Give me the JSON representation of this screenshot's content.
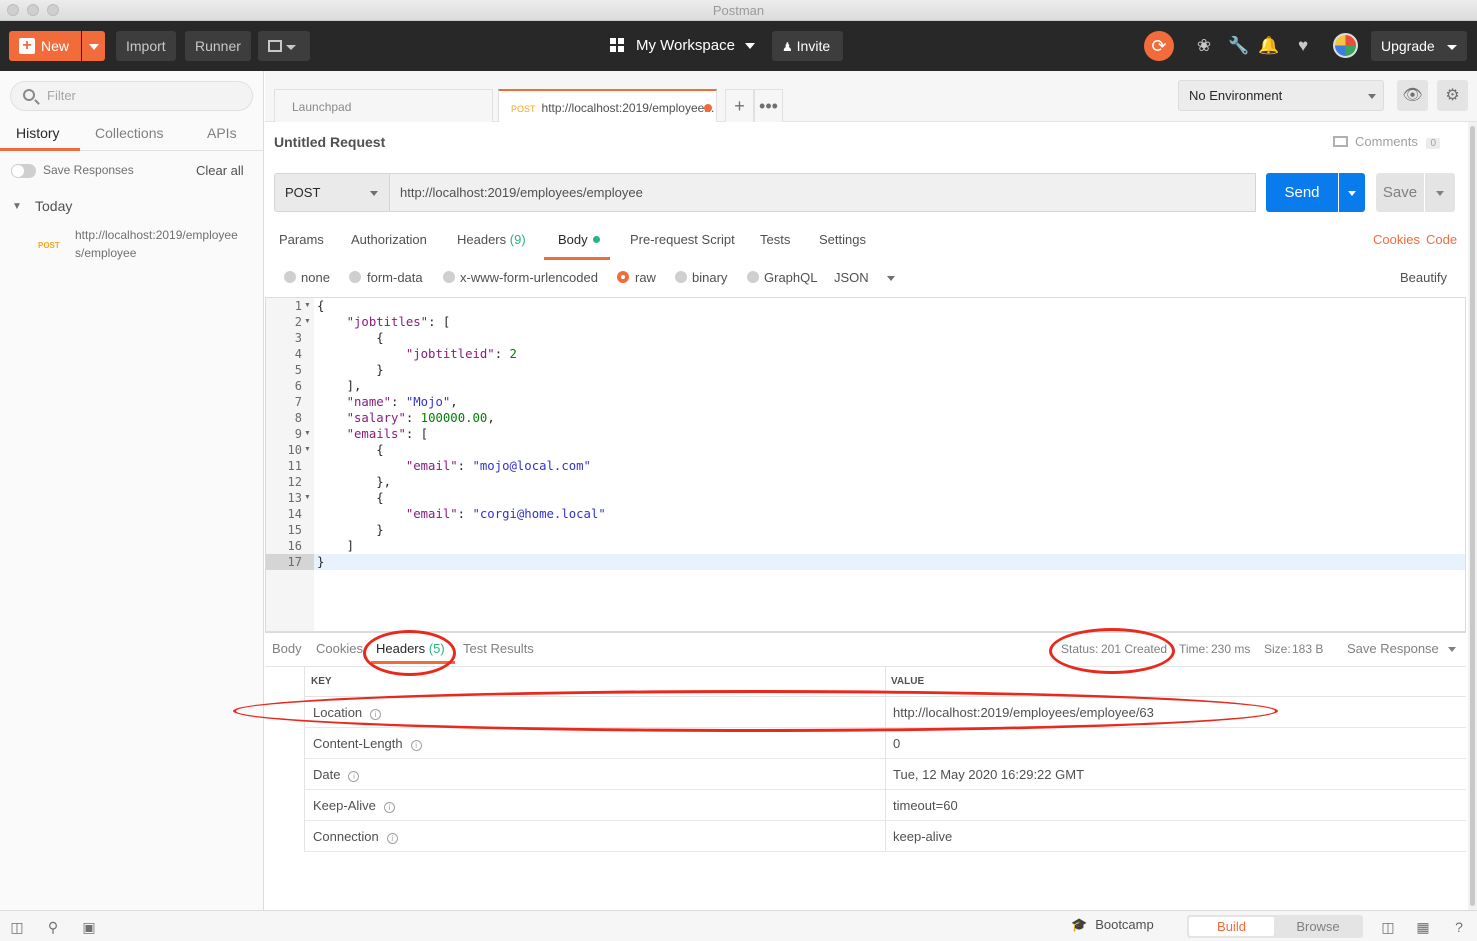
{
  "window": {
    "title": "Postman"
  },
  "header": {
    "new_label": "New",
    "import_label": "Import",
    "runner_label": "Runner",
    "workspace_label": "My Workspace",
    "invite_label": "Invite",
    "upgrade_label": "Upgrade"
  },
  "sidebar": {
    "filter_placeholder": "Filter",
    "tabs": [
      "History",
      "Collections",
      "APIs"
    ],
    "save_responses_label": "Save Responses",
    "clear_all_label": "Clear all",
    "group_label": "Today",
    "history_items": [
      {
        "method": "POST",
        "url_line1": "http://localhost:2019/employee",
        "url_line2": "s/employee"
      }
    ]
  },
  "tabs": {
    "launchpad_label": "Launchpad",
    "active_method": "POST",
    "active_label": "http://localhost:2019/employee..."
  },
  "environment": {
    "selected": "No Environment"
  },
  "request": {
    "title": "Untitled Request",
    "comments_label": "Comments",
    "comments_count": "0",
    "method": "POST",
    "url": "http://localhost:2019/employees/employee",
    "send_label": "Send",
    "save_label": "Save",
    "tabs": {
      "params": "Params",
      "authorization": "Authorization",
      "headers": "Headers",
      "headers_count": "(9)",
      "body": "Body",
      "prerequest": "Pre-request Script",
      "tests": "Tests",
      "settings": "Settings"
    },
    "cookies_label": "Cookies",
    "code_label": "Code",
    "body_types": [
      "none",
      "form-data",
      "x-www-form-urlencoded",
      "raw",
      "binary",
      "GraphQL"
    ],
    "body_format": "JSON",
    "beautify_label": "Beautify"
  },
  "editor": {
    "lines": [
      "{",
      "    \"jobtitles\": [",
      "        {",
      "            \"jobtitleid\": 2",
      "        }",
      "    ],",
      "    \"name\": \"Mojo\",",
      "    \"salary\": 100000.00,",
      "    \"emails\": [",
      "        {",
      "            \"email\": \"mojo@local.com\"",
      "        },",
      "        {",
      "            \"email\": \"corgi@home.local\"",
      "        }",
      "    ]",
      "}"
    ]
  },
  "response": {
    "tabs": {
      "body": "Body",
      "cookies": "Cookies",
      "headers": "Headers",
      "headers_count": "(5)",
      "test_results": "Test Results"
    },
    "status_label": "Status:",
    "status_value": "201 Created",
    "time_label": "Time:",
    "time_value": "230 ms",
    "size_label": "Size:",
    "size_value": "183 B",
    "save_response_label": "Save Response",
    "table": {
      "key_header": "KEY",
      "value_header": "VALUE",
      "rows": [
        {
          "key": "Location",
          "value": "http://localhost:2019/employees/employee/63"
        },
        {
          "key": "Content-Length",
          "value": "0"
        },
        {
          "key": "Date",
          "value": "Tue, 12 May 2020 16:29:22 GMT"
        },
        {
          "key": "Keep-Alive",
          "value": "timeout=60"
        },
        {
          "key": "Connection",
          "value": "keep-alive"
        }
      ]
    }
  },
  "statusbar": {
    "bootcamp_label": "Bootcamp",
    "build_label": "Build",
    "browse_label": "Browse"
  },
  "colors": {
    "accent": "#f26b3a",
    "send": "#097bed",
    "success": "#26b47f",
    "annotation": "#e8291c"
  }
}
